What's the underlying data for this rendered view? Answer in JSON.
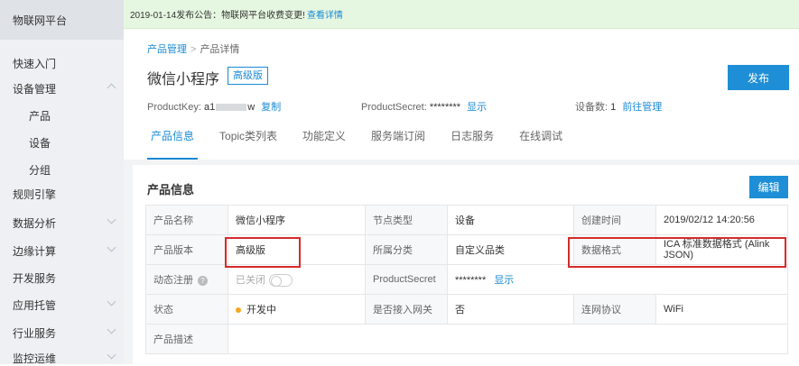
{
  "sidebar": {
    "brand": "物联网平台",
    "quick_start": "快速入门",
    "device_mgmt": "设备管理",
    "sub": [
      "产品",
      "设备",
      "分组"
    ],
    "rules": "规则引擎",
    "data_analysis": "数据分析",
    "edge": "边缘计算",
    "dev_service": "开发服务",
    "app_hosting": "应用托管",
    "industry": "行业服务",
    "monitoring": "监控运维"
  },
  "notice": {
    "text": "2019-01-14发布公告：物联网平台收费变更!",
    "link": "查看详情"
  },
  "breadcrumb": {
    "parent": "产品管理",
    "sep": ">",
    "current": "产品详情"
  },
  "product": {
    "name": "微信小程序",
    "edition_badge": "高级版",
    "publish_label": "发布",
    "product_key_label": "ProductKey:",
    "product_key_value": "a1",
    "product_key_tail": "w",
    "copy_label": "复制",
    "product_secret_label": "ProductSecret:",
    "product_secret_value": "********",
    "show_label": "显示",
    "device_count_label": "设备数:",
    "device_count_value": "1",
    "manage_label": "前往管理"
  },
  "tabs": [
    "产品信息",
    "Topic类列表",
    "功能定义",
    "服务端订阅",
    "日志服务",
    "在线调试"
  ],
  "info": {
    "title": "产品信息",
    "edit_label": "编辑",
    "rows": {
      "r1": [
        "产品名称",
        "微信小程序",
        "节点类型",
        "设备",
        "创建时间",
        "2019/02/12 14:20:56"
      ],
      "r2": [
        "产品版本",
        "高级版",
        "所属分类",
        "自定义品类",
        "数据格式",
        "ICA 标准数据格式 (Alink JSON)"
      ],
      "r3": [
        "动态注册",
        "已关闭",
        "ProductSecret",
        "********",
        "显示"
      ],
      "r4": [
        "状态",
        "开发中",
        "是否接入网关",
        "否",
        "连网协议",
        "WiFi"
      ],
      "r5": [
        "产品描述"
      ]
    }
  },
  "colors": {
    "accent": "#1a8ad4",
    "highlight_box": "#d52b2b",
    "status_dot": "#f5a623"
  }
}
